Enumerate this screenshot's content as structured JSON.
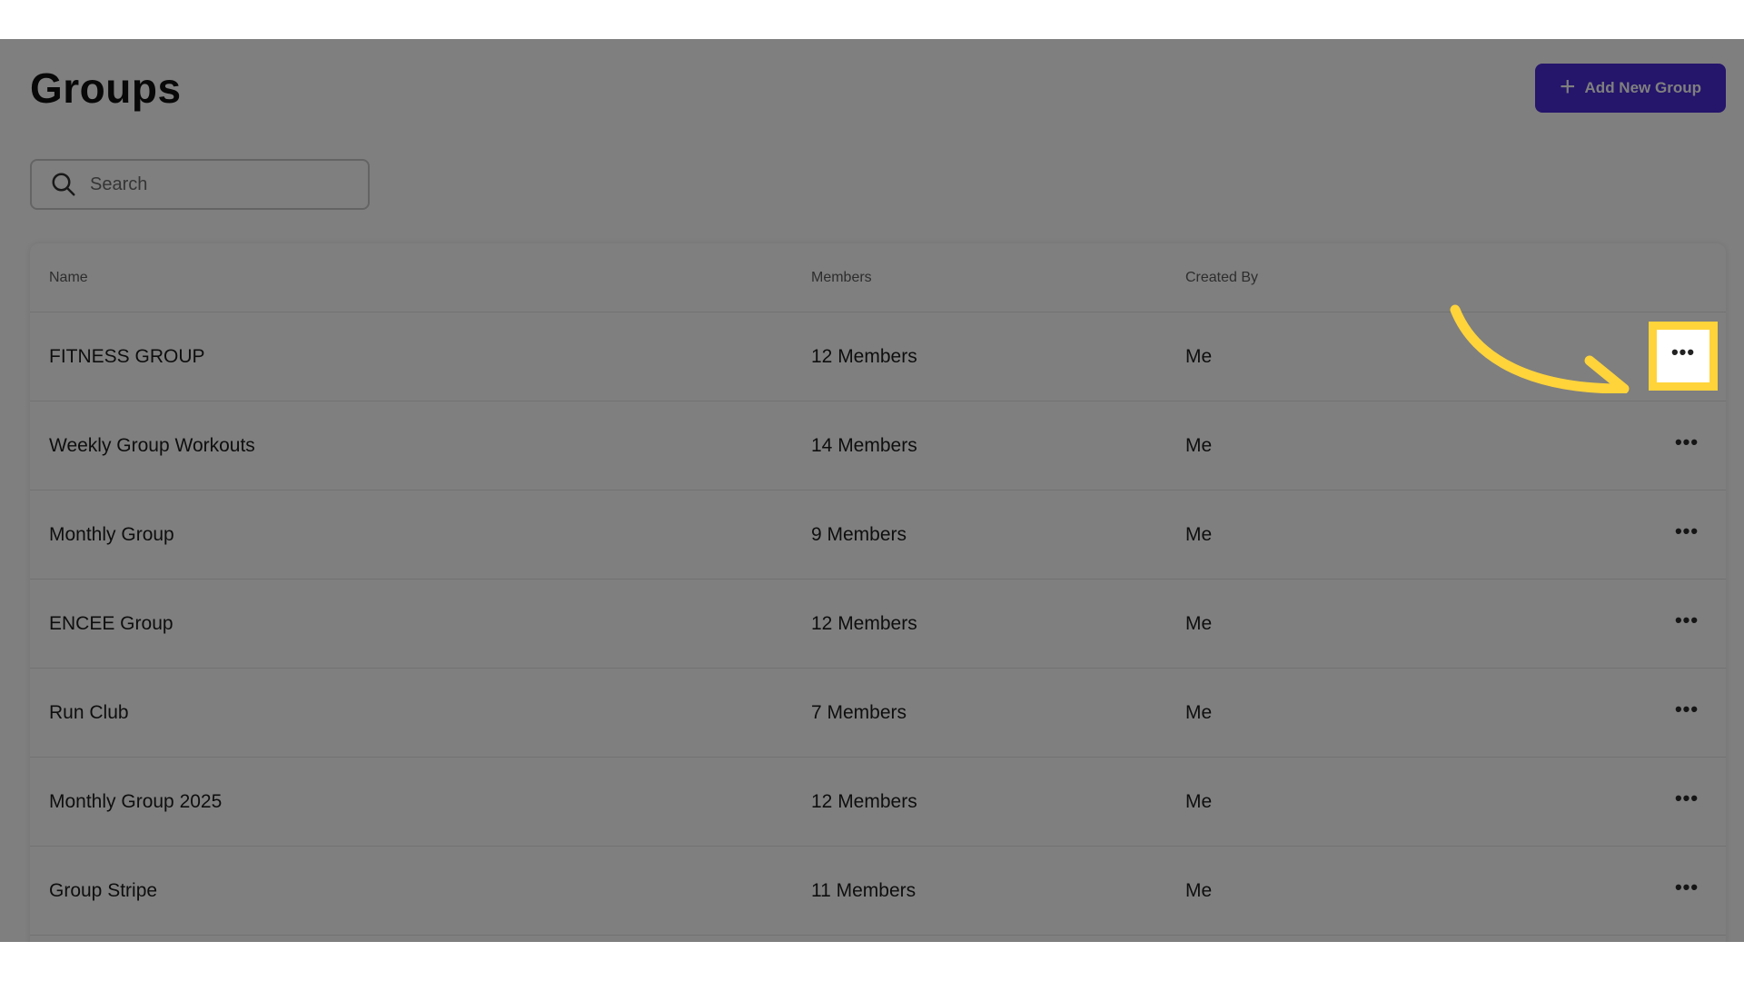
{
  "header": {
    "title": "Groups",
    "add_button_label": "Add New Group",
    "add_button_icon": "plus-icon"
  },
  "search": {
    "placeholder": "Search",
    "value": "",
    "icon": "search-icon"
  },
  "table": {
    "columns": [
      "Name",
      "Members",
      "Created By"
    ],
    "rows": [
      {
        "name": "FITNESS GROUP",
        "members": "12 Members",
        "created_by": "Me"
      },
      {
        "name": "Weekly Group Workouts",
        "members": "14 Members",
        "created_by": "Me"
      },
      {
        "name": "Monthly Group",
        "members": "9 Members",
        "created_by": "Me"
      },
      {
        "name": "ENCEE Group",
        "members": "12 Members",
        "created_by": "Me"
      },
      {
        "name": "Run Club",
        "members": "7 Members",
        "created_by": "Me"
      },
      {
        "name": "Monthly Group 2025",
        "members": "12 Members",
        "created_by": "Me"
      },
      {
        "name": "Group Stripe",
        "members": "11 Members",
        "created_by": "Me"
      }
    ],
    "row_action_icon": "more-horizontal-icon",
    "row_action_glyph": "•••"
  },
  "annotation": {
    "highlight_color": "#ffd43b",
    "highlighted_row_index": 0,
    "arrow_icon": "curved-arrow-icon"
  },
  "colors": {
    "accent": "#4b2ad6",
    "overlay": "rgba(0,0,0,0.5)"
  }
}
